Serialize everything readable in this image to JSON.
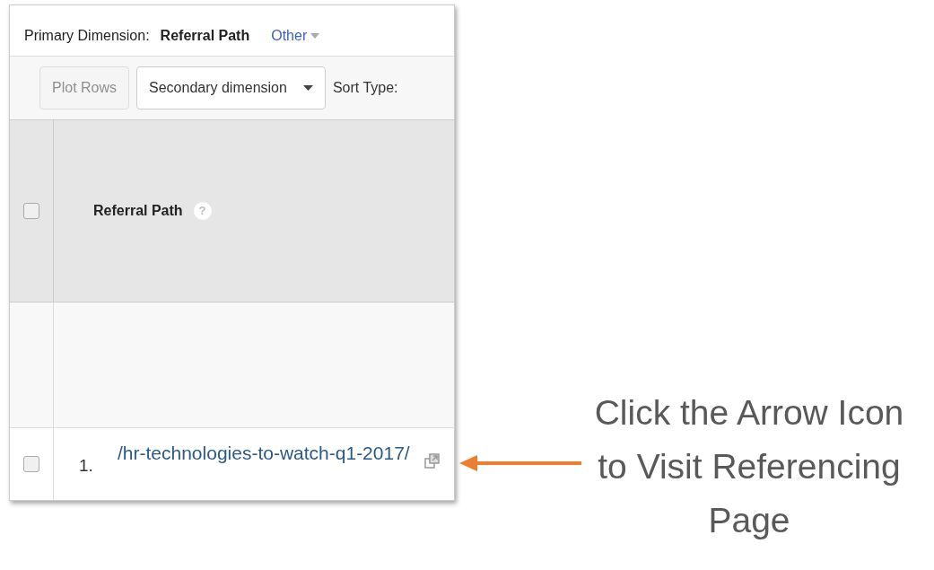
{
  "primary_dimension": {
    "label": "Primary Dimension:",
    "selected": "Referral Path",
    "other": "Other"
  },
  "toolbar": {
    "plot_rows": {
      "label": "Plot Rows",
      "disabled": true
    },
    "secondary_dimension": "Secondary dimension",
    "sort_type": "Sort Type:"
  },
  "table": {
    "header_checkbox": {
      "checked": false
    },
    "columns": [
      {
        "label": "Referral Path",
        "help": "?"
      }
    ],
    "rows": [
      {
        "index": "1.",
        "path": "/hr-technologies-to-watch-q1-2017/",
        "checked": false
      }
    ]
  },
  "annotation": {
    "text": "Click the Arrow Icon to Visit Referencing Page"
  }
}
